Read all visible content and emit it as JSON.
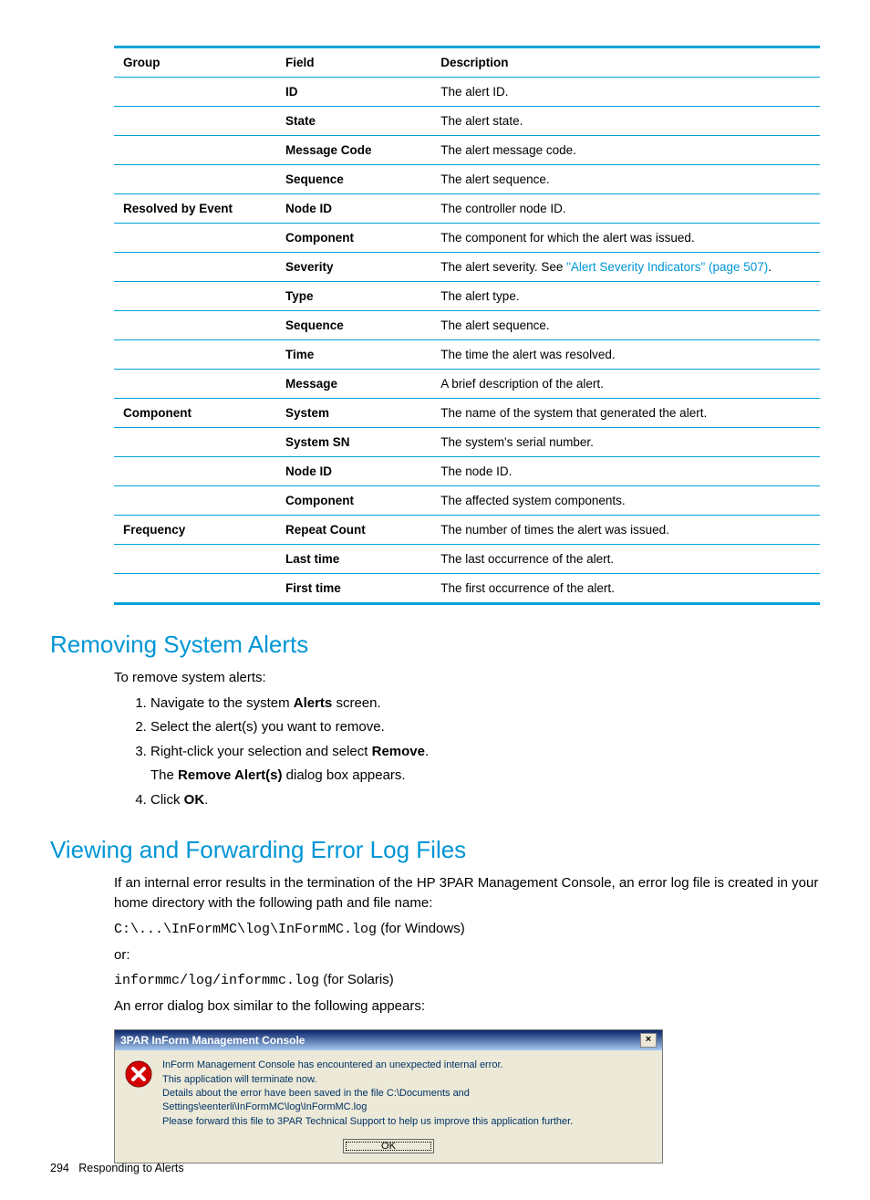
{
  "table": {
    "headers": {
      "group": "Group",
      "field": "Field",
      "desc": "Description"
    },
    "rows": [
      {
        "group": "",
        "field": "ID",
        "desc_pre": "The alert ID."
      },
      {
        "group": "",
        "field": "State",
        "desc_pre": "The alert state."
      },
      {
        "group": "",
        "field": "Message Code",
        "desc_pre": "The alert message code."
      },
      {
        "group": "",
        "field": "Sequence",
        "desc_pre": "The alert sequence."
      },
      {
        "group": "Resolved by Event",
        "field": "Node ID",
        "desc_pre": "The controller node ID."
      },
      {
        "group": "",
        "field": "Component",
        "desc_pre": "The component for which the alert was issued."
      },
      {
        "group": "",
        "field": "Severity",
        "desc_pre": "The alert severity. See ",
        "link": "\"Alert Severity Indicators\" (page 507)",
        "desc_post": "."
      },
      {
        "group": "",
        "field": "Type",
        "desc_pre": "The alert type."
      },
      {
        "group": "",
        "field": "Sequence",
        "desc_pre": "The alert sequence."
      },
      {
        "group": "",
        "field": "Time",
        "desc_pre": "The time the alert was resolved."
      },
      {
        "group": "",
        "field": "Message",
        "desc_pre": "A brief description of the alert."
      },
      {
        "group": "Component",
        "field": "System",
        "desc_pre": "The name of the system that generated the alert."
      },
      {
        "group": "",
        "field": "System SN",
        "desc_pre": "The system's serial number."
      },
      {
        "group": "",
        "field": "Node ID",
        "desc_pre": "The node ID."
      },
      {
        "group": "",
        "field": "Component",
        "desc_pre": "The affected system components."
      },
      {
        "group": "Frequency",
        "field": "Repeat Count",
        "desc_pre": "The number of times the alert was issued."
      },
      {
        "group": "",
        "field": "Last time",
        "desc_pre": "The last occurrence of the alert."
      },
      {
        "group": "",
        "field": "First time",
        "desc_pre": "The first occurrence of the alert."
      }
    ]
  },
  "sections": {
    "removing": {
      "title": "Removing System Alerts",
      "intro": "To remove system alerts:",
      "step1_a": "Navigate to the system ",
      "step1_b": "Alerts",
      "step1_c": " screen.",
      "step2": "Select the alert(s) you want to remove.",
      "step3_a": "Right-click your selection and select ",
      "step3_b": "Remove",
      "step3_c": ".",
      "step3_sub_a": "The ",
      "step3_sub_b": "Remove Alert(s)",
      "step3_sub_c": " dialog box appears.",
      "step4_a": "Click ",
      "step4_b": "OK",
      "step4_c": "."
    },
    "viewing": {
      "title": "Viewing and Forwarding Error Log Files",
      "p1": "If an internal error results in the termination of the HP 3PAR Management Console, an error log file is created in your home directory with the following path and file name:",
      "path1_code": "C:\\...\\InFormMC\\log\\InFormMC.log",
      "path1_suffix": " (for Windows)",
      "or": "or:",
      "path2_code": "informmc/log/informmc.log",
      "path2_suffix": " (for Solaris)",
      "p2": "An error dialog box similar to the following appears:"
    }
  },
  "dialog": {
    "title": "3PAR InForm Management Console",
    "close": "×",
    "line1": "InForm Management Console has encountered an unexpected internal error.",
    "line2": "This application will terminate now.",
    "line3": "Details about the error have been saved in the file C:\\Documents and Settings\\eenterli\\InFormMC\\log\\InFormMC.log",
    "line4": "Please forward this file to 3PAR Technical Support to help us improve this application further.",
    "ok": "OK"
  },
  "footer": {
    "page": "294",
    "section": "Responding to Alerts"
  }
}
